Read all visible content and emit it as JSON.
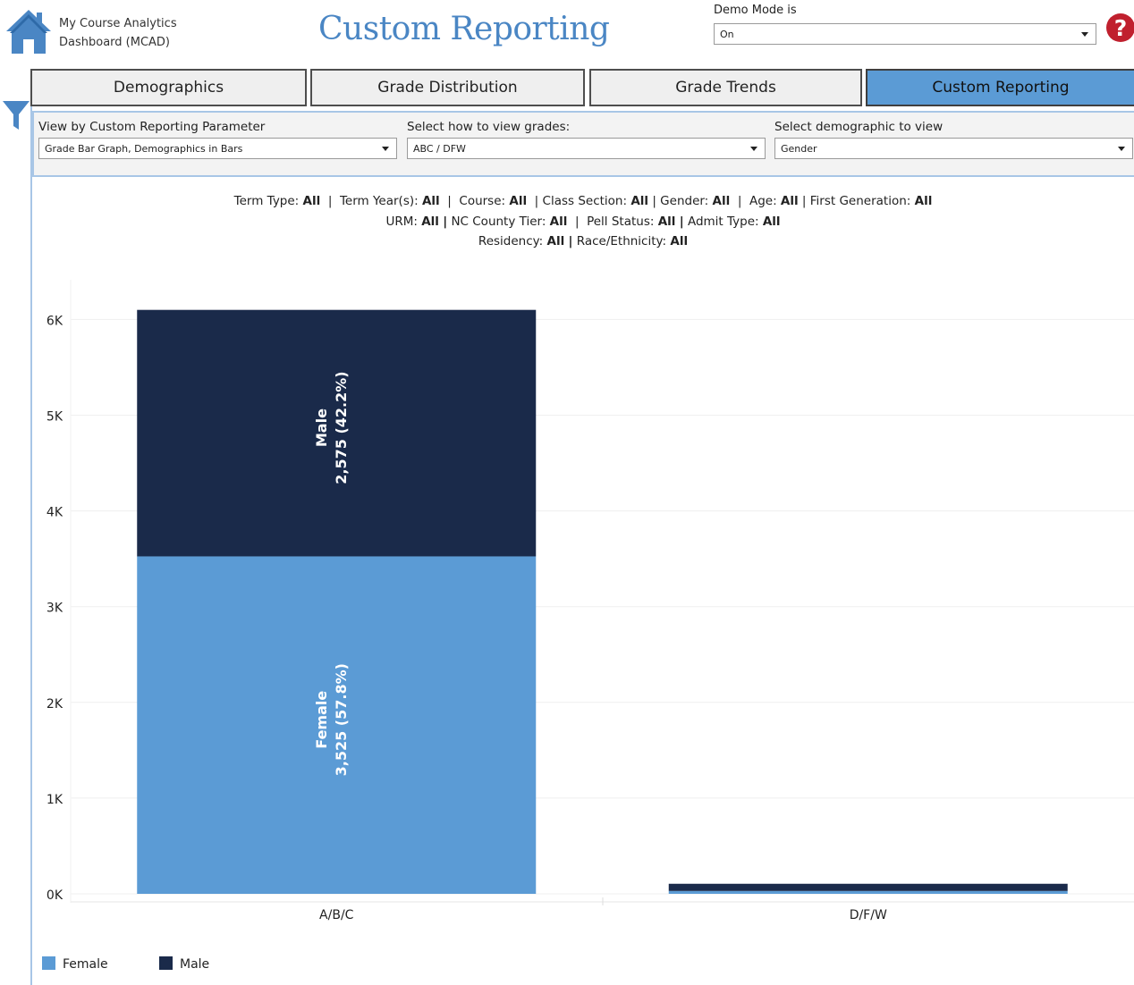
{
  "header": {
    "app_name_line1": "My Course Analytics",
    "app_name_line2": "Dashboard (MCAD)",
    "page_title": "Custom Reporting",
    "demo_mode": {
      "label": "Demo Mode is",
      "value": "On"
    },
    "icons": {
      "home": "home-icon",
      "help": "help-icon",
      "filter": "filter-icon"
    }
  },
  "tabs": [
    {
      "label": "Demographics",
      "active": false
    },
    {
      "label": "Grade Distribution",
      "active": false
    },
    {
      "label": "Grade Trends",
      "active": false
    },
    {
      "label": "Custom Reporting",
      "active": true
    }
  ],
  "parameters": [
    {
      "label": "View by Custom Reporting Parameter",
      "value": "Grade Bar Graph, Demographics in Bars"
    },
    {
      "label": "Select how to view grades:",
      "value": "ABC / DFW"
    },
    {
      "label": "Select demographic to view",
      "value": "Gender"
    }
  ],
  "filters": {
    "term_type": {
      "label": "Term Type:",
      "value": "All"
    },
    "term_years": {
      "label": "Term Year(s):",
      "value": "All"
    },
    "course": {
      "label": "Course:",
      "value": "All"
    },
    "class_section": {
      "label": "Class Section:",
      "value": "All"
    },
    "gender": {
      "label": "Gender:",
      "value": "All"
    },
    "age": {
      "label": "Age:",
      "value": "All"
    },
    "first_generation": {
      "label": "First Generation:",
      "value": "All"
    },
    "urm": {
      "label": "URM:",
      "value": "All"
    },
    "nc_county_tier": {
      "label": "NC County Tier:",
      "value": "All"
    },
    "pell_status": {
      "label": "Pell Status:",
      "value": "All"
    },
    "admit_type": {
      "label": "Admit Type:",
      "value": "All"
    },
    "residency": {
      "label": "Residency:",
      "value": "All"
    },
    "race_ethnicity": {
      "label": "Race/Ethnicity:",
      "value": "All"
    }
  },
  "chart_data": {
    "type": "bar",
    "stacked": true,
    "categories": [
      "A/B/C",
      "D/F/W"
    ],
    "series": [
      {
        "name": "Female",
        "values": [
          3525,
          30
        ],
        "color": "#5b9bd5",
        "labels": [
          "Female",
          ""
        ],
        "value_labels": [
          "3,525 (57.8%)",
          ""
        ]
      },
      {
        "name": "Male",
        "values": [
          2575,
          75
        ],
        "color": "#1a2a4a",
        "labels": [
          "Male",
          ""
        ],
        "value_labels": [
          "2,575 (42.2%)",
          ""
        ]
      }
    ],
    "y_ticks": [
      0,
      1000,
      2000,
      3000,
      4000,
      5000,
      6000
    ],
    "y_tick_labels": [
      "0K",
      "1K",
      "2K",
      "3K",
      "4K",
      "5K",
      "6K"
    ],
    "ylim": [
      0,
      6000
    ],
    "grid": true,
    "legend_position": "bottom-left"
  }
}
